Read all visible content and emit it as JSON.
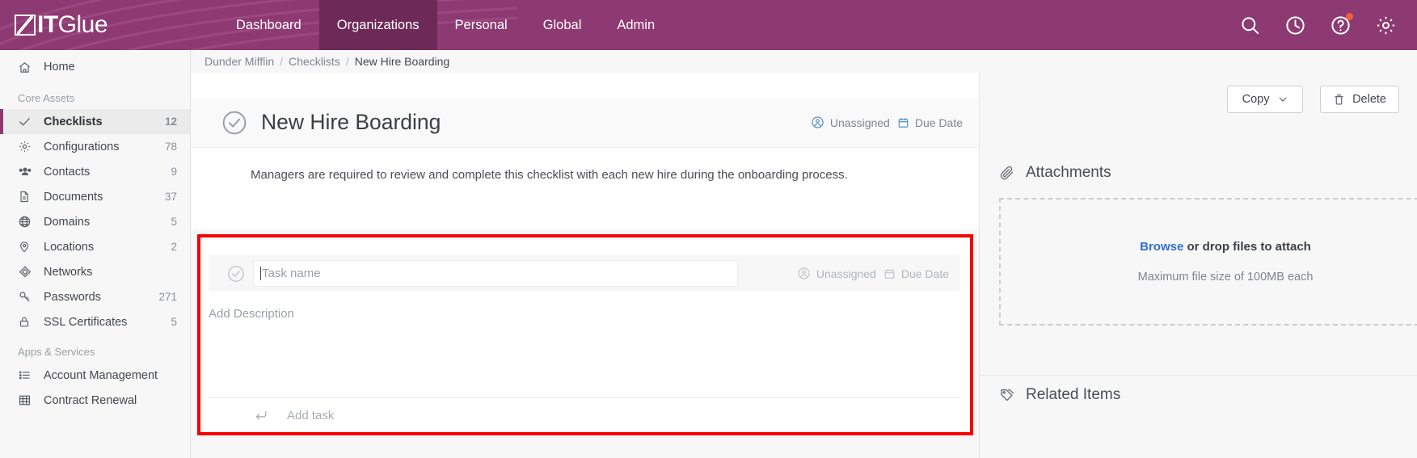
{
  "brand": {
    "name_bold": "IT",
    "name_light": "Glue",
    "mark": "itglue-logo-mark"
  },
  "topnav": {
    "links": [
      {
        "label": "Dashboard",
        "active": false
      },
      {
        "label": "Organizations",
        "active": true
      },
      {
        "label": "Personal",
        "active": false
      },
      {
        "label": "Global",
        "active": false
      },
      {
        "label": "Admin",
        "active": false
      }
    ],
    "icons": [
      {
        "name": "search-icon"
      },
      {
        "name": "history-clock-icon"
      },
      {
        "name": "help-icon",
        "badge": true
      },
      {
        "name": "gear-icon"
      }
    ],
    "background_color": "#8e3a72",
    "active_color": "#6d2a58"
  },
  "sidebar": {
    "home": {
      "label": "Home",
      "icon": "home-icon"
    },
    "groups": [
      {
        "title": "Core Assets",
        "items": [
          {
            "label": "Checklists",
            "count": "12",
            "icon": "check-icon",
            "active": true
          },
          {
            "label": "Configurations",
            "count": "78",
            "icon": "gear-icon",
            "active": false
          },
          {
            "label": "Contacts",
            "count": "9",
            "icon": "contacts-icon",
            "active": false
          },
          {
            "label": "Documents",
            "count": "37",
            "icon": "document-icon",
            "active": false
          },
          {
            "label": "Domains",
            "count": "5",
            "icon": "globe-icon",
            "active": false
          },
          {
            "label": "Locations",
            "count": "2",
            "icon": "map-pin-icon",
            "active": false
          },
          {
            "label": "Networks",
            "count": "",
            "icon": "network-icon",
            "active": false
          },
          {
            "label": "Passwords",
            "count": "271",
            "icon": "key-icon",
            "active": false
          },
          {
            "label": "SSL Certificates",
            "count": "5",
            "icon": "lock-icon",
            "active": false
          }
        ]
      },
      {
        "title": "Apps & Services",
        "items": [
          {
            "label": "Account Management",
            "count": "",
            "icon": "list-icon",
            "active": false
          },
          {
            "label": "Contract Renewal",
            "count": "",
            "icon": "table-icon",
            "active": false
          }
        ]
      }
    ]
  },
  "breadcrumb": {
    "organization": "Dunder Mifflin",
    "section": "Checklists",
    "current": "New Hire Boarding",
    "separator": "/"
  },
  "checklist": {
    "title": "New Hire Boarding",
    "status_icon": "circle-check-icon",
    "assignee": "Unassigned",
    "assignee_icon": "user-circle-icon",
    "due_date": "Due Date",
    "due_date_icon": "calendar-icon",
    "description": "Managers are required to review and complete this checklist with each new hire during the onboarding process."
  },
  "task_editor": {
    "highlight_color": "#f80000",
    "check_icon": "circle-check-icon",
    "task_name_placeholder": "Task name",
    "task_name_value": "",
    "assignee": "Unassigned",
    "assignee_icon": "user-circle-icon",
    "due_date": "Due Date",
    "due_date_icon": "calendar-icon",
    "description_placeholder": "Add Description",
    "add_task_label": "Add task",
    "add_task_icon": "enter-return-icon"
  },
  "right_panel": {
    "copy_label": "Copy",
    "copy_chevron_icon": "chevron-down-icon",
    "delete_label": "Delete",
    "delete_icon": "trash-icon",
    "attachments": {
      "title": "Attachments",
      "icon": "paperclip-icon",
      "browse_link": "Browse",
      "drop_text": " or drop files to attach",
      "max_size_text": "Maximum file size of 100MB each",
      "link_color": "#2f6fd0"
    },
    "related_items": {
      "title": "Related Items",
      "icon": "tag-icon"
    }
  }
}
